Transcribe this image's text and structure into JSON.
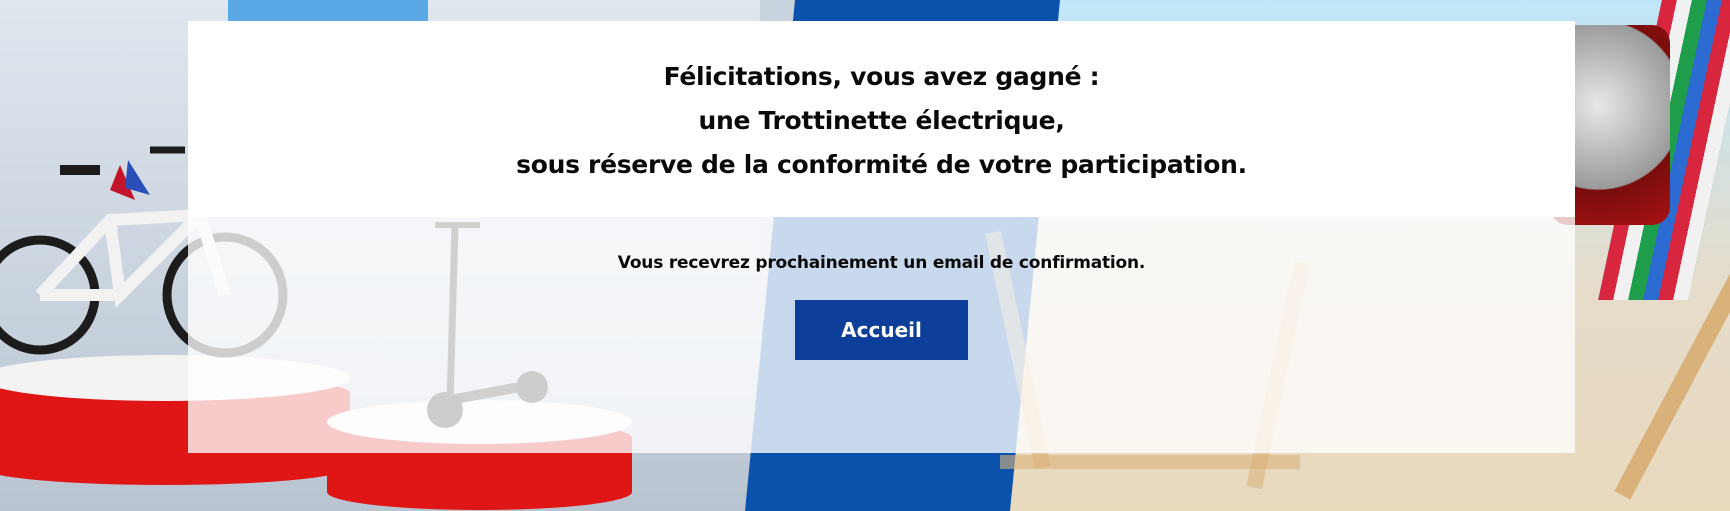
{
  "confirmation": {
    "headline_line1": "Félicitations, vous avez gagné :",
    "headline_line2": "une Trottinette électrique,",
    "headline_line3": "sous réserve de la conformité de votre participation.",
    "email_notice": "Vous recevrez prochainement un email de confirmation.",
    "home_button_label": "Accueil"
  },
  "colors": {
    "button_background": "#0d3f9a",
    "button_text": "#ffffff",
    "panel_background": "#ffffff",
    "accent_blue_stripe": "#0b52ac",
    "podium_red": "#e01515"
  },
  "background_scene": {
    "items": [
      "electric-bike",
      "electric-scooter",
      "deck-chair",
      "engine-toy"
    ]
  }
}
